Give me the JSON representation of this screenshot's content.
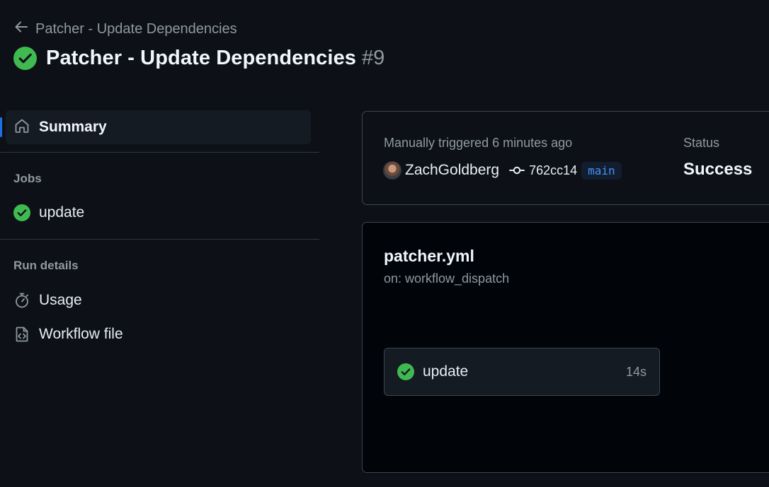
{
  "header": {
    "back_label": "Patcher - Update Dependencies",
    "title": "Patcher - Update Dependencies",
    "run_number": "#9"
  },
  "sidebar": {
    "summary_label": "Summary",
    "jobs_heading": "Jobs",
    "jobs": [
      {
        "label": "update",
        "status": "success"
      }
    ],
    "run_details_heading": "Run details",
    "run_details": [
      {
        "label": "Usage",
        "icon": "stopwatch-icon"
      },
      {
        "label": "Workflow file",
        "icon": "file-code-icon"
      }
    ]
  },
  "summary": {
    "trigger_text": "Manually triggered 6 minutes ago",
    "actor": "ZachGoldberg",
    "commit_sha": "762cc14",
    "branch": "main",
    "status_label": "Status",
    "status_value": "Success"
  },
  "workflow": {
    "file_name": "patcher.yml",
    "trigger": "on: workflow_dispatch",
    "job": {
      "name": "update",
      "duration": "14s",
      "status": "success"
    }
  },
  "colors": {
    "background": "#0d1117",
    "success": "#3fb950",
    "accent": "#1f6feb",
    "branch_text": "#4493f8"
  }
}
